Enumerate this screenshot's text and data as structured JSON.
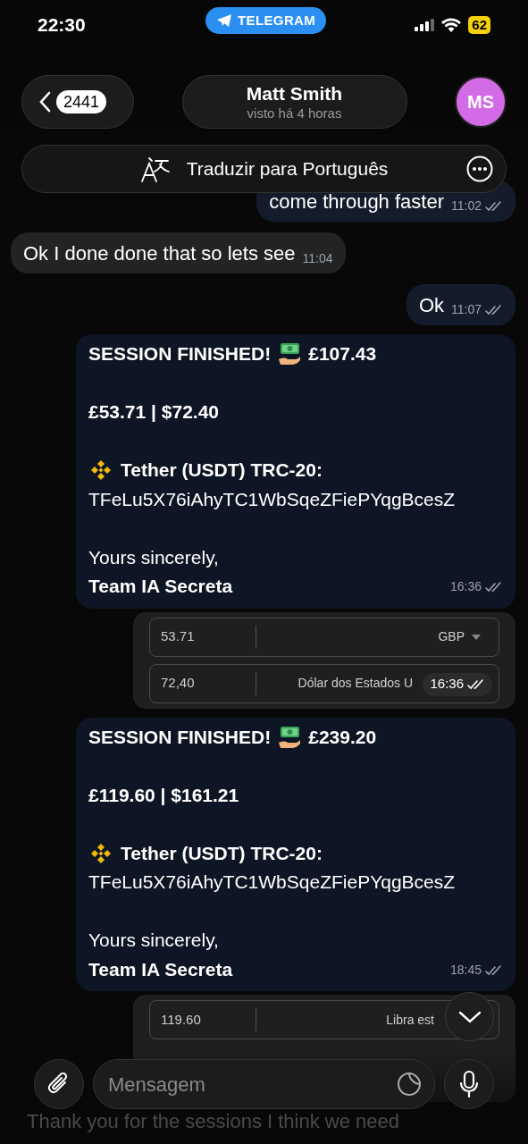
{
  "status_bar": {
    "time": "22:30",
    "app_pill": "TELEGRAM",
    "battery": "62"
  },
  "header": {
    "back_count": "2441",
    "name": "Matt Smith",
    "last_seen": "visto há 4 horas",
    "avatar_initials": "MS"
  },
  "translate_bar": {
    "label": "Traduzir para Português"
  },
  "messages": [
    {
      "kind": "outgoing",
      "text": "come through faster",
      "time": "11:02",
      "read": true
    },
    {
      "kind": "incoming",
      "text": "Ok I done done that so lets see",
      "time": "11:04"
    },
    {
      "kind": "outgoing",
      "text": "Ok",
      "time": "11:07",
      "read": true
    },
    {
      "kind": "session",
      "title": "SESSION FINISHED!",
      "total": "£107.43",
      "amounts": "£53.71 | $72.40",
      "network": "Tether (USDT) TRC-20:",
      "address": "TFeLu5X76iAhyTC1WbSqeZFiePYqgBcesZ",
      "closing": "Yours sincerely,",
      "signature": "Team IA Secreta",
      "time": "16:36",
      "read": true
    },
    {
      "kind": "converter",
      "rows": [
        {
          "amount": "53.71",
          "currency": "GBP",
          "dropdown": true
        },
        {
          "amount": "72,40",
          "currency": "Dólar dos Estados U",
          "dropdown": false
        }
      ],
      "time": "16:36",
      "read": true
    },
    {
      "kind": "session",
      "title": "SESSION FINISHED!",
      "total": "£239.20",
      "amounts": "£119.60 | $161.21",
      "network": "Tether (USDT) TRC-20:",
      "address": "TFeLu5X76iAhyTC1WbSqeZFiePYqgBcesZ",
      "closing": "Yours sincerely,",
      "signature": "Team IA Secreta",
      "time": "18:45",
      "read": true
    },
    {
      "kind": "converter",
      "rows": [
        {
          "amount": "119.60",
          "currency": "Libra est",
          "dropdown": false
        }
      ]
    }
  ],
  "composer": {
    "placeholder": "Mensagem"
  },
  "behind_text": "Thank you for the sessions I think we need"
}
